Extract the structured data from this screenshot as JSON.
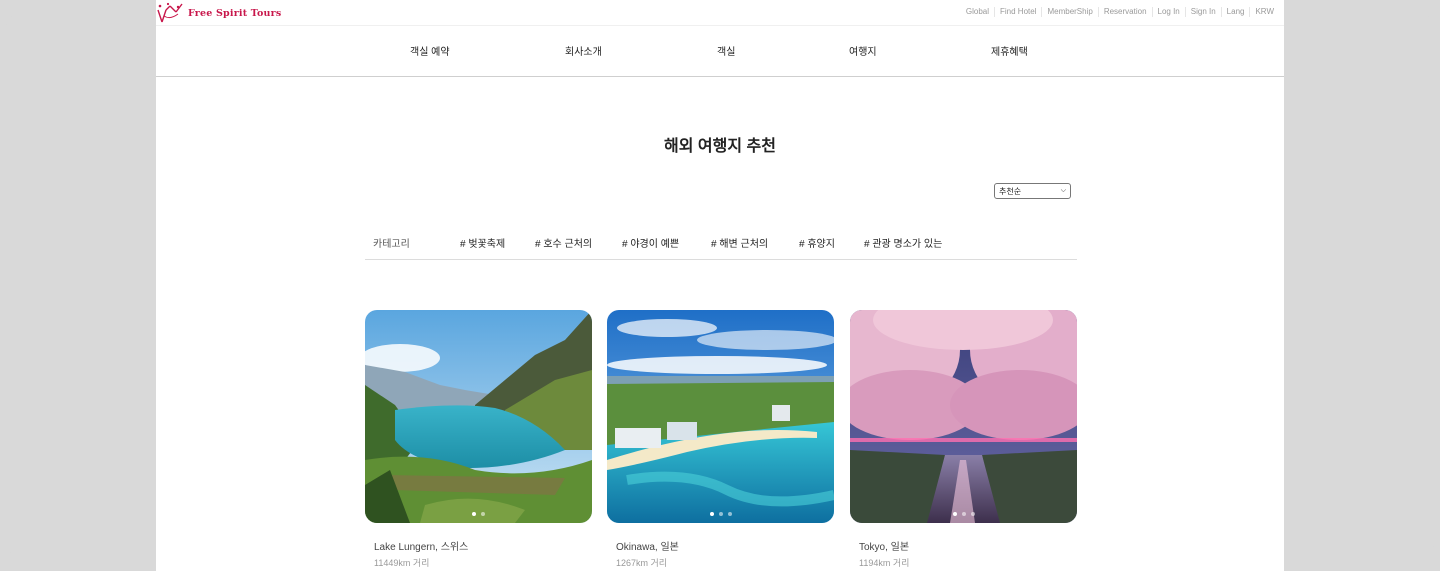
{
  "brand": {
    "name": "Free Spirit Tours",
    "color": "#c8174b"
  },
  "utility_nav": [
    "Global",
    "Find Hotel",
    "MemberShip",
    "Reservation",
    "Log In",
    "Sign In",
    "Lang",
    "KRW"
  ],
  "main_nav": [
    "객실 예약",
    "회사소개",
    "객실",
    "여행지",
    "제휴혜택"
  ],
  "page_title": "해외 여행지 추천",
  "sort": {
    "selected": "추천순"
  },
  "filters": {
    "label": "카테고리",
    "tags": [
      "# 벚꽃축제",
      "# 호수 근처의",
      "# 야경이 예쁜",
      "# 해변 근처의",
      "# 휴양지",
      "# 관광 명소가 있는"
    ]
  },
  "destinations": [
    {
      "name": "Lake Lungern, 스위스",
      "distance": "11449km 거리",
      "image_icon": "lake-mountain-photo"
    },
    {
      "name": "Okinawa, 일본",
      "distance": "1267km 거리",
      "image_icon": "beach-resort-photo"
    },
    {
      "name": "Tokyo, 일본",
      "distance": "1194km 거리",
      "image_icon": "cherry-blossom-river-photo"
    }
  ]
}
